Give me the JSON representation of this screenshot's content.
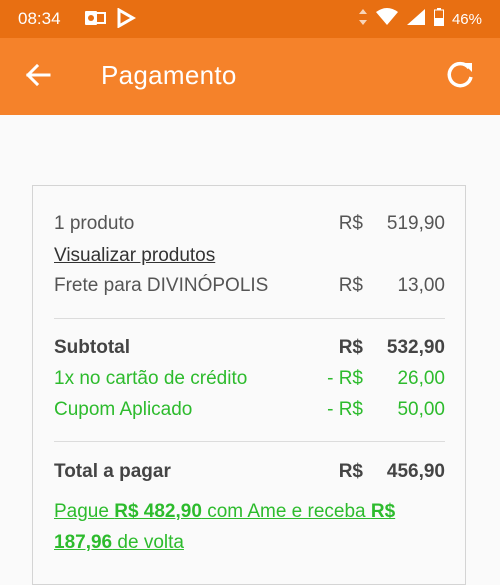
{
  "status_bar": {
    "time": "08:34",
    "battery": "46%",
    "icons": [
      "outlook-icon",
      "flag-icon",
      "data-arrows-icon",
      "wifi-icon",
      "signal-icon",
      "battery-icon"
    ]
  },
  "header": {
    "title": "Pagamento",
    "back_icon": "arrow-left-icon",
    "refresh_icon": "refresh-icon",
    "background": "#f5822a"
  },
  "summary": {
    "product": {
      "label": "1 produto",
      "currency": "R$",
      "value": "519,90"
    },
    "view_products_link": "Visualizar produtos",
    "shipping": {
      "label": "Frete para DIVINÓPOLIS",
      "currency": "R$",
      "value": "13,00"
    },
    "subtotal": {
      "label": "Subtotal",
      "currency": "R$",
      "value": "532,90"
    },
    "credit_discount": {
      "label": "1x no cartão de crédito",
      "currency": "- R$",
      "value": "26,00"
    },
    "coupon": {
      "label": "Cupom Aplicado",
      "currency": "- R$",
      "value": "50,00"
    },
    "total": {
      "label": "Total a pagar",
      "currency": "R$",
      "value": "456,90"
    },
    "ame_promo": {
      "part1": "Pague ",
      "amount": "R$ 482,90",
      "part2": " com Ame e receba ",
      "cashback": "R$ 187,96",
      "part3": " de volta"
    }
  },
  "colors": {
    "accent": "#f5822a",
    "status_bar": "#e86f12",
    "discount_green": "#2dbb2d"
  }
}
